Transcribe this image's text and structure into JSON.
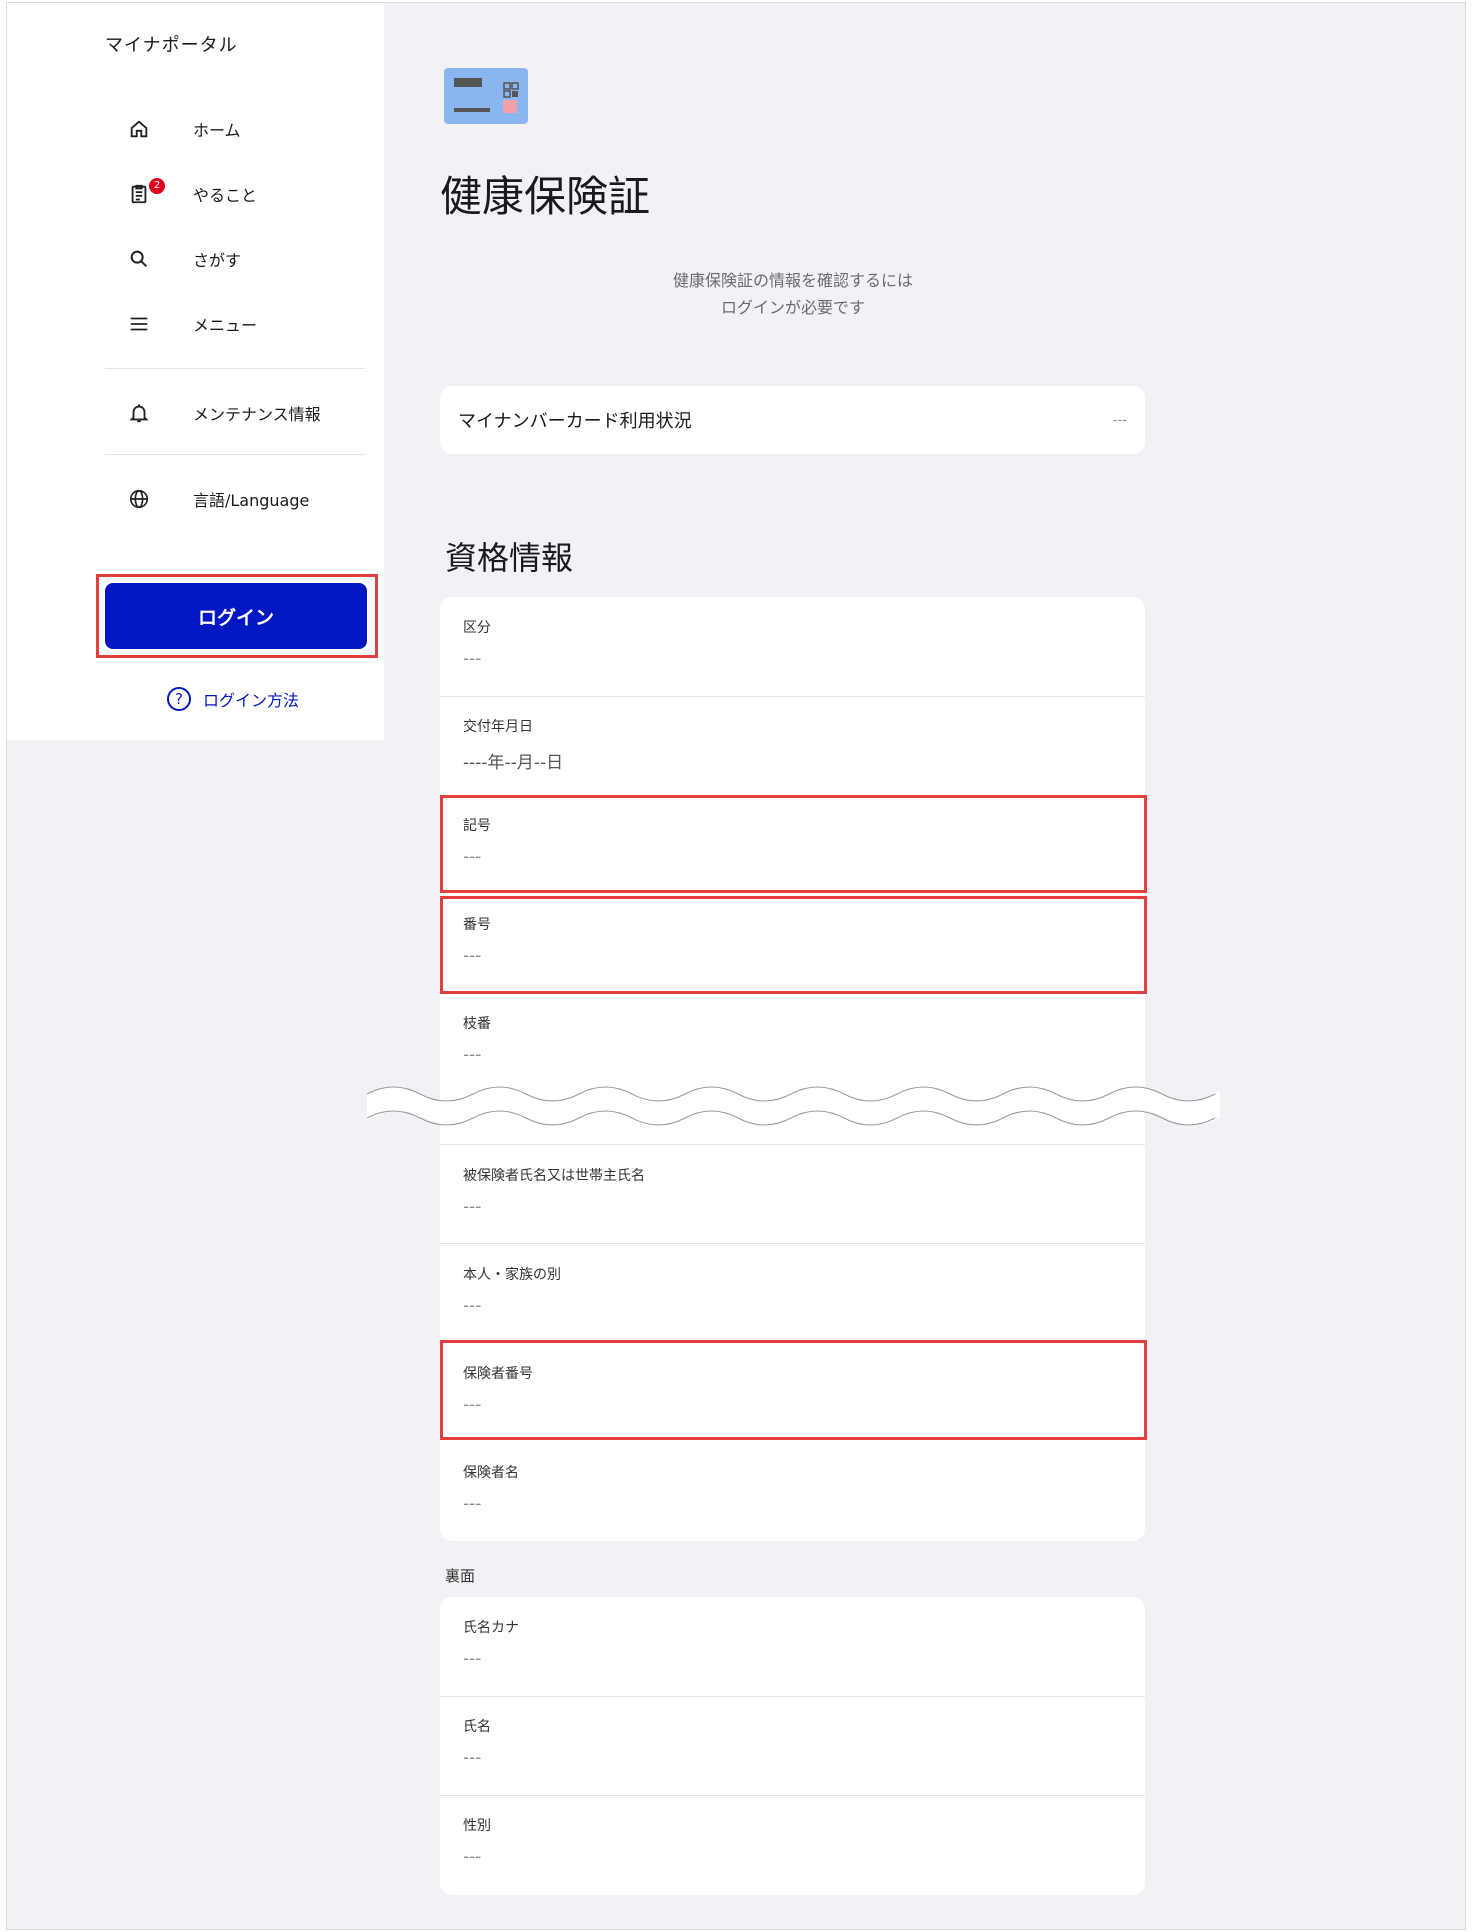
{
  "app": {
    "brand": "マイナポータル"
  },
  "sidebar": {
    "items": [
      {
        "label": "ホーム",
        "icon": "home-icon"
      },
      {
        "label": "やること",
        "icon": "todo-list-icon",
        "badge": "2"
      },
      {
        "label": "さがす",
        "icon": "search-icon"
      },
      {
        "label": "メニュー",
        "icon": "menu-icon"
      },
      {
        "label": "メンテナンス情報",
        "icon": "bell-icon"
      },
      {
        "label": "言語/Language",
        "icon": "globe-icon"
      }
    ],
    "login_label": "ログイン",
    "howto_label": "ログイン方法"
  },
  "main": {
    "title": "健康保険証",
    "notice_line1": "健康保険証の情報を確認するには",
    "notice_line2": "ログインが必要です",
    "status": {
      "label": "マイナンバーカード利用状況",
      "value": "---"
    },
    "section_title": "資格情報",
    "qualification": [
      {
        "label": "区分",
        "value": "---"
      },
      {
        "label": "交付年月日",
        "value": "----年--月--日"
      },
      {
        "label": "記号",
        "value": "---"
      },
      {
        "label": "番号",
        "value": "---"
      },
      {
        "label": "枝番",
        "value": "---"
      },
      {
        "label": "被保険者氏名又は世帯主氏名",
        "value": "---"
      },
      {
        "label": "本人・家族の別",
        "value": "---"
      },
      {
        "label": "保険者番号",
        "value": "---"
      },
      {
        "label": "保険者名",
        "value": "---"
      }
    ],
    "back_title": "裏面",
    "back": [
      {
        "label": "氏名カナ",
        "value": "---"
      },
      {
        "label": "氏名",
        "value": "---"
      },
      {
        "label": "性別",
        "value": "---"
      }
    ]
  },
  "colors": {
    "accent": "#0017c1",
    "highlight": "#e53e3e",
    "badge": "#e0001b",
    "background": "#f1f1f6"
  }
}
